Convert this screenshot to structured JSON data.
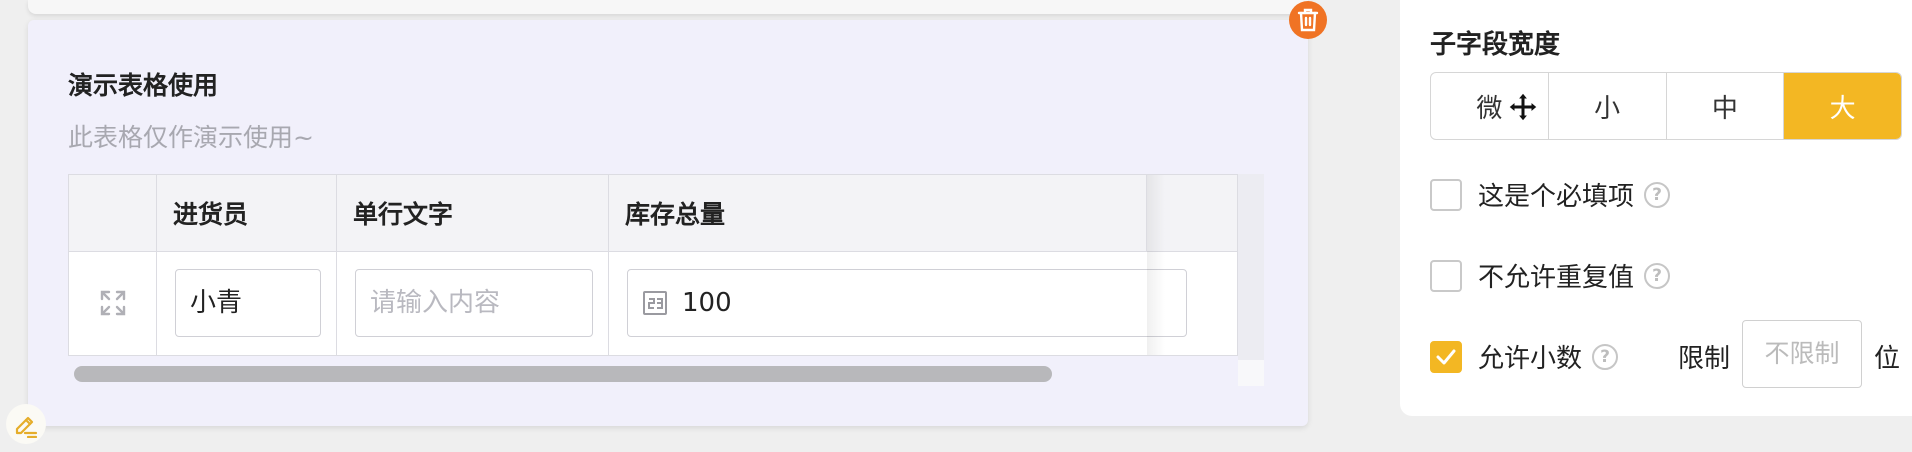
{
  "form_field": {
    "title": "演示表格使用",
    "description": "此表格仅作演示使用~",
    "table": {
      "columns": [
        "进货员",
        "单行文字",
        "库存总量"
      ],
      "row": {
        "buyer": "小青",
        "text_placeholder": "请输入内容",
        "stock": "100"
      }
    }
  },
  "settings_panel": {
    "width_label": "子字段宽度",
    "width_options": [
      "微",
      "小",
      "中",
      "大"
    ],
    "selected_width": "大",
    "required_label": "这是个必填项",
    "no_duplicate_label": "不允许重复值",
    "allow_decimal_label": "允许小数",
    "limit_label": "限制",
    "limit_placeholder": "不限制",
    "limit_unit": "位",
    "help_glyph": "?",
    "required_checked": false,
    "no_duplicate_checked": false,
    "allow_decimal_checked": true
  },
  "colors": {
    "accent": "#f3b723",
    "delete": "#f07324",
    "card_bg": "#f1f0fb"
  }
}
